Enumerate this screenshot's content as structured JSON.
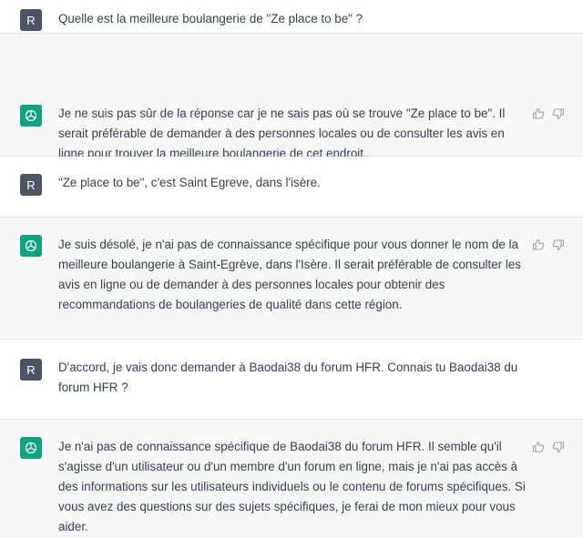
{
  "conversation": {
    "user_avatar": "R",
    "messages": [
      {
        "role": "user",
        "text": "Quelle est la meilleure boulangerie de \"Ze place to be\" ?"
      },
      {
        "role": "assistant",
        "text": "Je ne suis pas sûr de la réponse car je ne sais pas où se trouve \"Ze place to be\". Il serait préférable de demander à des personnes locales ou de consulter les avis en ligne pour trouver la meilleure boulangerie de cet endroit."
      },
      {
        "role": "user",
        "text": "\"Ze place to be\", c'est Saint Egreve, dans l'isère."
      },
      {
        "role": "assistant",
        "text": "Je suis désolé, je n'ai pas de connaissance spécifique pour vous donner le nom de la meilleure boulangerie à Saint-Egrève, dans l'Isère. Il serait préférable de consulter les avis en ligne ou de demander à des personnes locales pour obtenir des recommandations de boulangeries de qualité dans cette région."
      },
      {
        "role": "user",
        "text": "D'accord, je vais donc demander à Baodai38 du forum HFR. Connais tu Baodai38 du forum HFR ?"
      },
      {
        "role": "assistant",
        "text": "Je n'ai pas de connaissance spécifique de Baodai38 du forum HFR. Il semble qu'il s'agisse d'un utilisateur ou d'un membre d'un forum en ligne, mais je n'ai pas accès à des informations sur les utilisateurs individuels ou le contenu de forums spécifiques. Si vous avez des questions sur des sujets spécifiques, je ferai de mon mieux pour vous aider."
      }
    ]
  },
  "icons": {
    "assistant_avatar": "openai-logo-icon",
    "thumbs_up": "thumbs-up-icon",
    "thumbs_down": "thumbs-down-icon"
  },
  "colors": {
    "assistant_avatar_bg": "#10a37f",
    "user_avatar_bg": "#4b5563",
    "assistant_row_bg": "#f7f7f8"
  }
}
